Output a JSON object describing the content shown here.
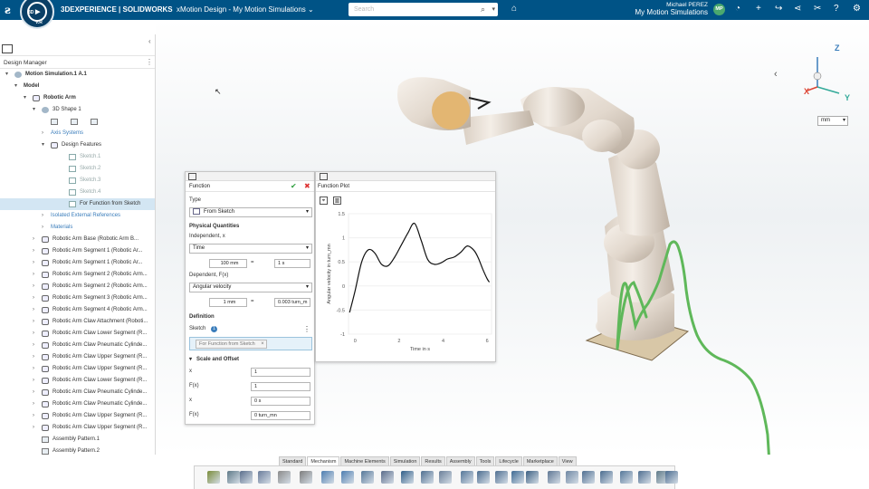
{
  "topbar": {
    "brand": "3DEXPERIENCE | SOLIDWORKS",
    "app": "xMotion Design - My Motion Simulations",
    "search_placeholder": "Search",
    "user_name": "Michael PEREZ",
    "user_title": "My Motion Simulations",
    "avatar_initials": "MP",
    "compass_label": "V.R",
    "compass_3d": "3D"
  },
  "left_panel": {
    "header": "Design Manager",
    "tree": [
      {
        "label": "Motion Simulation.1 A.1",
        "depth": 0,
        "toggle": "▾",
        "icon": "gear",
        "style": "bold"
      },
      {
        "label": "Model",
        "depth": 1,
        "toggle": "▾",
        "icon": "",
        "style": "bold"
      },
      {
        "label": "Robotic Arm",
        "depth": 2,
        "toggle": "▾",
        "icon": "part",
        "style": "bold"
      },
      {
        "label": "3D Shape 1",
        "depth": 3,
        "toggle": "▾",
        "icon": "gear",
        "style": ""
      },
      {
        "label": "",
        "depth": 4,
        "toggle": "",
        "icon": "icons-row",
        "style": ""
      },
      {
        "label": "Axis Systems",
        "depth": 4,
        "toggle": "›",
        "icon": "",
        "style": "blue"
      },
      {
        "label": "Design Features",
        "depth": 4,
        "toggle": "▾",
        "icon": "part",
        "style": ""
      },
      {
        "label": "Sketch.1",
        "depth": 6,
        "toggle": "",
        "icon": "sk",
        "style": "grey"
      },
      {
        "label": "Sketch.2",
        "depth": 6,
        "toggle": "",
        "icon": "sk",
        "style": "grey"
      },
      {
        "label": "Sketch.3",
        "depth": 6,
        "toggle": "",
        "icon": "sk",
        "style": "grey"
      },
      {
        "label": "Sketch.4",
        "depth": 6,
        "toggle": "",
        "icon": "sk",
        "style": "grey"
      },
      {
        "label": "For Function from Sketch",
        "depth": 6,
        "toggle": "",
        "icon": "sk",
        "style": "sel"
      },
      {
        "label": "Isolated External References",
        "depth": 4,
        "toggle": "›",
        "icon": "",
        "style": "blue"
      },
      {
        "label": "Materials",
        "depth": 4,
        "toggle": "›",
        "icon": "",
        "style": "blue"
      },
      {
        "label": "Robotic Arm Base (Robotic Arm B...",
        "depth": 3,
        "toggle": "›",
        "icon": "part",
        "style": ""
      },
      {
        "label": "Robotic Arm Segment 1  (Robotic Ar...",
        "depth": 3,
        "toggle": "›",
        "icon": "part",
        "style": ""
      },
      {
        "label": "Robotic Arm Segment 1  (Robotic Ar...",
        "depth": 3,
        "toggle": "›",
        "icon": "part",
        "style": ""
      },
      {
        "label": "Robotic Arm Segment 2 (Robotic Arm...",
        "depth": 3,
        "toggle": "›",
        "icon": "part",
        "style": ""
      },
      {
        "label": "Robotic Arm Segment 2 (Robotic Arm...",
        "depth": 3,
        "toggle": "›",
        "icon": "part",
        "style": ""
      },
      {
        "label": "Robotic Arm Segment 3 (Robotic Arm...",
        "depth": 3,
        "toggle": "›",
        "icon": "part",
        "style": ""
      },
      {
        "label": "Robotic Arm Segment 4 (Robotic Arm...",
        "depth": 3,
        "toggle": "›",
        "icon": "part",
        "style": ""
      },
      {
        "label": "Robotic Arm Claw Attachment (Roboti...",
        "depth": 3,
        "toggle": "›",
        "icon": "part",
        "style": ""
      },
      {
        "label": "Robotic Arm Claw Lower Segment (R...",
        "depth": 3,
        "toggle": "›",
        "icon": "part",
        "style": ""
      },
      {
        "label": "Robotic Arm Claw Pneumatic Cylinde...",
        "depth": 3,
        "toggle": "›",
        "icon": "part",
        "style": ""
      },
      {
        "label": "Robotic Arm Claw Upper Segment (R...",
        "depth": 3,
        "toggle": "›",
        "icon": "part",
        "style": ""
      },
      {
        "label": "Robotic Arm Claw Upper Segment (R...",
        "depth": 3,
        "toggle": "›",
        "icon": "part",
        "style": ""
      },
      {
        "label": "Robotic Arm Claw Lower Segment (R...",
        "depth": 3,
        "toggle": "›",
        "icon": "part",
        "style": ""
      },
      {
        "label": "Robotic Arm Claw Pneumatic Cylinde...",
        "depth": 3,
        "toggle": "›",
        "icon": "part",
        "style": ""
      },
      {
        "label": "Robotic Arm Claw Pneumatic Cylinde...",
        "depth": 3,
        "toggle": "›",
        "icon": "part",
        "style": ""
      },
      {
        "label": "Robotic Arm Claw Upper Segment (R...",
        "depth": 3,
        "toggle": "›",
        "icon": "part",
        "style": ""
      },
      {
        "label": "Robotic Arm Claw Upper Segment (R...",
        "depth": 3,
        "toggle": "›",
        "icon": "part",
        "style": ""
      },
      {
        "label": "Assembly Pattern.1",
        "depth": 3,
        "toggle": "",
        "icon": "pat",
        "style": ""
      },
      {
        "label": "Assembly Pattern.2",
        "depth": 3,
        "toggle": "",
        "icon": "pat",
        "style": ""
      }
    ]
  },
  "function_panel": {
    "title": "Function",
    "type_label": "Type",
    "type_value": "From Sketch",
    "physical_quantities": "Physical Quantities",
    "independent_label": "Independent, x",
    "independent_value": "Time",
    "indep_scale_left": "100 mm",
    "indep_eq": "=",
    "indep_scale_right": "1 s",
    "dependent_label": "Dependent, F(x)",
    "dependent_value": "Angular velocity",
    "dep_scale_left": "1 mm",
    "dep_eq": "=",
    "dep_scale_right": "0.003 turn_m",
    "definition": "Definition",
    "sketch_label": "Sketch",
    "sketch_count": "1",
    "sketch_chip": "For Function from Sketch",
    "scale_offset": "Scale and Offset",
    "rows": [
      {
        "label": "x",
        "value": "1"
      },
      {
        "label": "F(x)",
        "value": "1"
      },
      {
        "label": "x",
        "value": "0 s"
      },
      {
        "label": "F(x)",
        "value": "0 turn_mn"
      }
    ]
  },
  "plot_panel": {
    "title": "Function Plot"
  },
  "chart_data": {
    "type": "line",
    "title": "",
    "xlabel": "Time in s",
    "ylabel": "Angular velocity in turn_mn",
    "xlim": [
      -0.3,
      6.2
    ],
    "ylim": [
      -1,
      1.5
    ],
    "xticks": [
      "0",
      "2",
      "4",
      "6"
    ],
    "yticks": [
      "1.5",
      "1",
      "0.5",
      "0",
      "-0.5",
      "-1"
    ],
    "series": [
      {
        "name": "",
        "color": "#111111",
        "x": [
          -0.25,
          0.0,
          0.3,
          0.6,
          0.9,
          1.2,
          1.5,
          1.8,
          2.1,
          2.4,
          2.7,
          3.0,
          3.3,
          3.6,
          3.9,
          4.2,
          4.5,
          4.8,
          5.1,
          5.4,
          5.6,
          5.8,
          6.0,
          6.1
        ],
        "y": [
          -0.55,
          -0.1,
          0.5,
          0.75,
          0.68,
          0.45,
          0.42,
          0.6,
          0.85,
          1.1,
          1.3,
          0.95,
          0.55,
          0.45,
          0.48,
          0.56,
          0.6,
          0.7,
          0.83,
          0.74,
          0.58,
          0.35,
          0.15,
          0.08
        ]
      }
    ]
  },
  "viewport": {
    "unit": "mm",
    "axis_x": "X",
    "axis_y": "Y",
    "axis_z": "Z"
  },
  "bottom_tabs": [
    "Standard",
    "Mechanism",
    "Machine Elements",
    "Simulation",
    "Results",
    "Assembly",
    "Tools",
    "Lifecycle",
    "Marketplace",
    "View"
  ],
  "bottom_tab_active": "Mechanism",
  "colors": {
    "topbar": "#005386",
    "accent": "#3a7dbb",
    "selection": "#d3e6f3",
    "robot_body": "#e6ddd3",
    "trajectory": "#5fb85a",
    "ok": "#2e9e3e",
    "cancel": "#d33333"
  }
}
